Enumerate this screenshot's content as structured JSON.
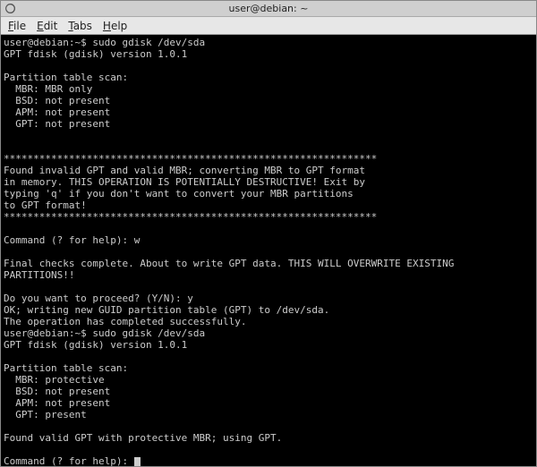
{
  "titlebar": {
    "title": "user@debian: ~"
  },
  "menubar": {
    "file": "File",
    "edit": "Edit",
    "tabs": "Tabs",
    "help": "Help"
  },
  "term": {
    "l01": "user@debian:~$ sudo gdisk /dev/sda",
    "l02": "GPT fdisk (gdisk) version 1.0.1",
    "l03": "",
    "l04": "Partition table scan:",
    "l05": "  MBR: MBR only",
    "l06": "  BSD: not present",
    "l07": "  APM: not present",
    "l08": "  GPT: not present",
    "l09": "",
    "l10": "",
    "l11": "***************************************************************",
    "l12": "Found invalid GPT and valid MBR; converting MBR to GPT format",
    "l13": "in memory. THIS OPERATION IS POTENTIALLY DESTRUCTIVE! Exit by",
    "l14": "typing 'q' if you don't want to convert your MBR partitions",
    "l15": "to GPT format!",
    "l16": "***************************************************************",
    "l17": "",
    "l18": "Command (? for help): w",
    "l19": "",
    "l20": "Final checks complete. About to write GPT data. THIS WILL OVERWRITE EXISTING",
    "l21": "PARTITIONS!!",
    "l22": "",
    "l23": "Do you want to proceed? (Y/N): y",
    "l24": "OK; writing new GUID partition table (GPT) to /dev/sda.",
    "l25": "The operation has completed successfully.",
    "l26": "user@debian:~$ sudo gdisk /dev/sda",
    "l27": "GPT fdisk (gdisk) version 1.0.1",
    "l28": "",
    "l29": "Partition table scan:",
    "l30": "  MBR: protective",
    "l31": "  BSD: not present",
    "l32": "  APM: not present",
    "l33": "  GPT: present",
    "l34": "",
    "l35": "Found valid GPT with protective MBR; using GPT.",
    "l36": "",
    "l37": "Command (? for help): "
  }
}
